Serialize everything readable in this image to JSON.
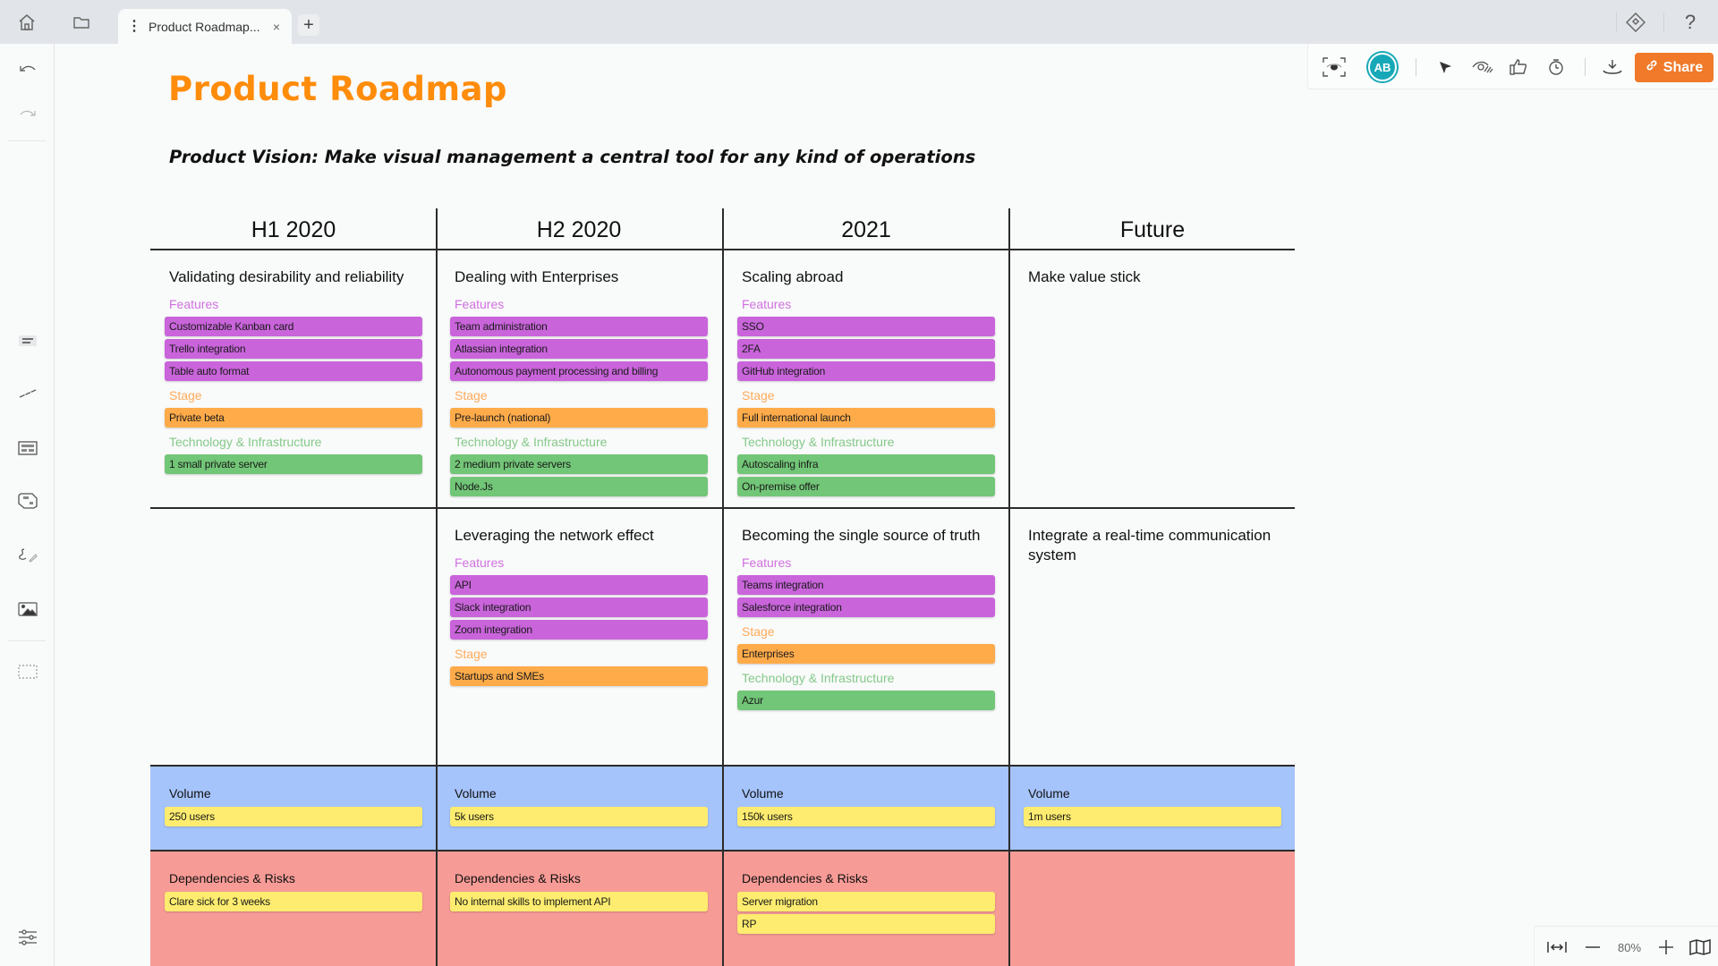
{
  "topbar": {
    "tab_title": "Product Roadmap...",
    "tab_close": "×",
    "new_tab": "+",
    "icons": [
      "home-icon",
      "folder-icon",
      "plugin-diamond-icon",
      "help-icon"
    ],
    "help": "?"
  },
  "toolbar": {
    "avatar_initials": "AB",
    "share_label": "Share",
    "icons": [
      "screen-capture-icon",
      "cursor-icon",
      "hide-eye-icon",
      "thumbs-up-icon",
      "timer-icon",
      "download-icon",
      "link-icon"
    ],
    "colors": {
      "share": "#f07a2a",
      "avatar": "#17a8b8"
    }
  },
  "sidebar": {
    "icons": [
      "undo-icon",
      "redo-icon",
      "sticky-note-icon",
      "line-icon",
      "table-icon",
      "shape-icon",
      "pen-icon",
      "image-icon",
      "frame-select-icon",
      "settings-sliders-icon"
    ]
  },
  "board": {
    "title": "Product Roadmap",
    "vision": "Product Vision: Make visual management a central tool for any kind of operations",
    "colors": {
      "title": "#ff8c0a",
      "features": "#c964db",
      "stage": "#ffab4a",
      "tech": "#72c677",
      "sticky": "#fdec6f",
      "volume_band": "#a6c4fc",
      "risk_band": "#f79b96"
    },
    "columns": [
      {
        "heading": "H1 2020",
        "rows": [
          {
            "title": "Validating desirability and reliability",
            "groups": [
              {
                "kind": "features",
                "label": "Features",
                "items": [
                  "Customizable Kanban card",
                  "Trello integration",
                  "Table auto format"
                ]
              },
              {
                "kind": "stage",
                "label": "Stage",
                "items": [
                  "Private beta"
                ]
              },
              {
                "kind": "tech",
                "label": "Technology & Infrastructure",
                "items": [
                  "1 small private server"
                ]
              }
            ]
          },
          null
        ],
        "volume": {
          "label": "Volume",
          "items": [
            "250 users"
          ]
        },
        "risks": {
          "label": "Dependencies & Risks",
          "items": [
            "Clare sick for 3 weeks"
          ]
        }
      },
      {
        "heading": "H2 2020",
        "rows": [
          {
            "title": "Dealing with Enterprises",
            "groups": [
              {
                "kind": "features",
                "label": "Features",
                "items": [
                  "Team administration",
                  "Atlassian integration",
                  "Autonomous payment processing and billing"
                ]
              },
              {
                "kind": "stage",
                "label": "Stage",
                "items": [
                  "Pre-launch (national)"
                ]
              },
              {
                "kind": "tech",
                "label": "Technology & Infrastructure",
                "items": [
                  "2 medium private servers",
                  "Node.Js"
                ]
              }
            ]
          },
          {
            "title": "Leveraging the network effect",
            "groups": [
              {
                "kind": "features",
                "label": "Features",
                "items": [
                  "API",
                  "Slack integration",
                  "Zoom integration"
                ]
              },
              {
                "kind": "stage",
                "label": "Stage",
                "items": [
                  "Startups and SMEs"
                ]
              }
            ]
          }
        ],
        "volume": {
          "label": "Volume",
          "items": [
            "5k users"
          ]
        },
        "risks": {
          "label": "Dependencies & Risks",
          "items": [
            "No internal skills to implement API"
          ]
        }
      },
      {
        "heading": "2021",
        "rows": [
          {
            "title": "Scaling abroad",
            "groups": [
              {
                "kind": "features",
                "label": "Features",
                "items": [
                  "SSO",
                  "2FA",
                  "GitHub integration"
                ]
              },
              {
                "kind": "stage",
                "label": "Stage",
                "items": [
                  "Full international launch"
                ]
              },
              {
                "kind": "tech",
                "label": "Technology & Infrastructure",
                "items": [
                  "Autoscaling infra",
                  "On-premise offer"
                ]
              }
            ]
          },
          {
            "title": "Becoming the single source of truth",
            "groups": [
              {
                "kind": "features",
                "label": "Features",
                "items": [
                  "Teams integration",
                  "Salesforce integration"
                ]
              },
              {
                "kind": "stage",
                "label": "Stage",
                "items": [
                  "Enterprises"
                ]
              },
              {
                "kind": "tech",
                "label": "Technology & Infrastructure",
                "items": [
                  "Azur"
                ]
              }
            ]
          }
        ],
        "volume": {
          "label": "Volume",
          "items": [
            "150k users"
          ]
        },
        "risks": {
          "label": "Dependencies & Risks",
          "items": [
            "Server migration",
            "RP"
          ]
        }
      },
      {
        "heading": "Future",
        "rows": [
          {
            "title": "Make value stick",
            "groups": []
          },
          {
            "title": "Integrate a real-time communication system",
            "groups": []
          }
        ],
        "volume": {
          "label": "Volume",
          "items": [
            "1m users"
          ]
        },
        "risks": null
      }
    ]
  },
  "zoom": {
    "level": "80%",
    "icons": [
      "fit-width-icon",
      "zoom-out-icon",
      "zoom-in-icon",
      "minimap-icon"
    ]
  }
}
